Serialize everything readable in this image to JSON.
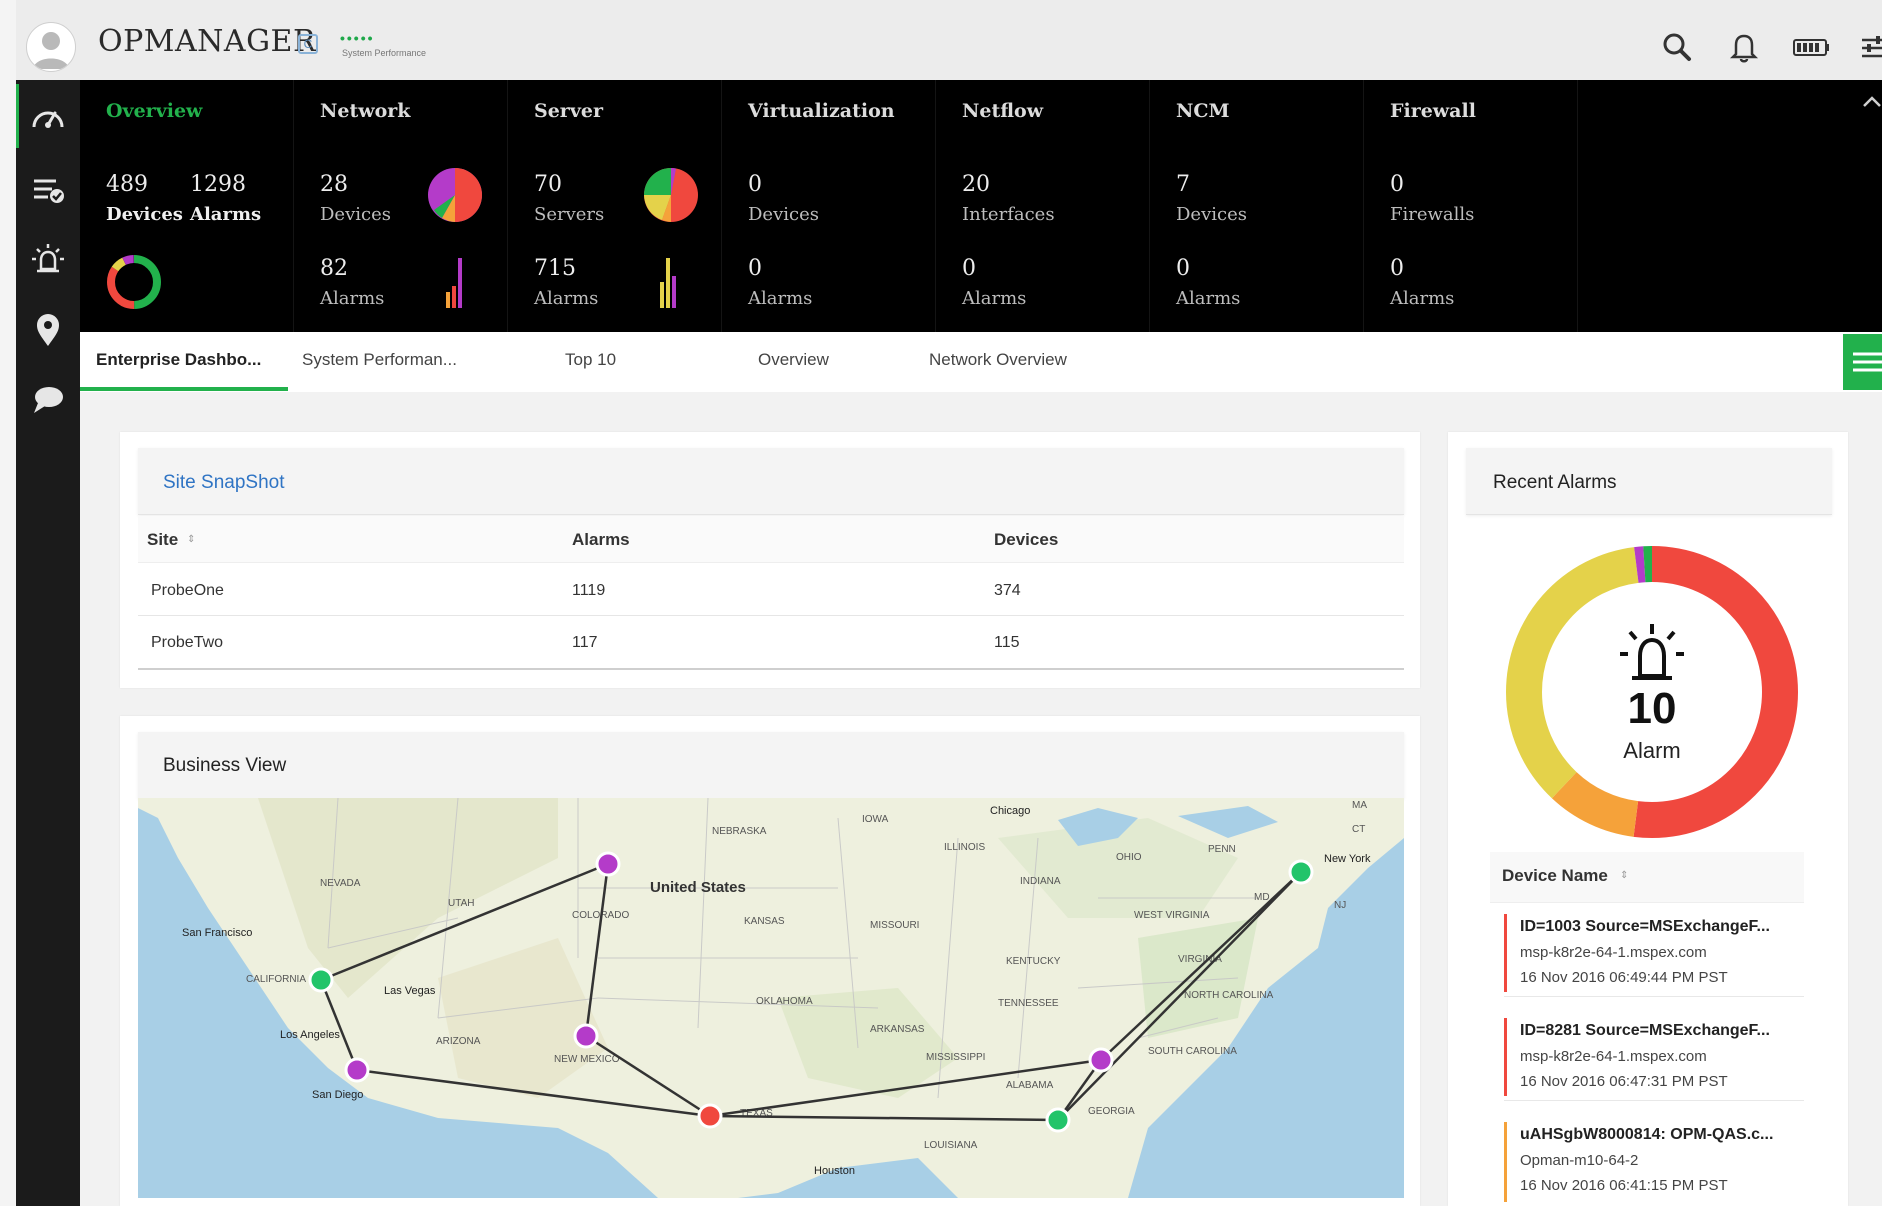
{
  "app": {
    "title": "OPMANAGER",
    "badge": "C",
    "perf_dots": "•••••",
    "perf_label": "System Performance"
  },
  "header_icons": [
    "search-icon",
    "bell-icon",
    "battery-icon",
    "settings-sliders-icon"
  ],
  "sidebar": [
    "dashboard-gauge-icon",
    "inventory-list-icon",
    "alarm-icon",
    "map-pin-icon",
    "chat-icon"
  ],
  "metrics": [
    {
      "title": "Overview",
      "v1": "489",
      "l1": "Devices",
      "v2": "1298",
      "l2": "Alarms"
    },
    {
      "title": "Network",
      "v1": "28",
      "l1": "Devices",
      "v2": "82",
      "l2": "Alarms"
    },
    {
      "title": "Server",
      "v1": "70",
      "l1": "Servers",
      "v2": "715",
      "l2": "Alarms"
    },
    {
      "title": "Virtualization",
      "v1": "0",
      "l1": "Devices",
      "v2": "0",
      "l2": "Alarms"
    },
    {
      "title": "Netflow",
      "v1": "20",
      "l1": "Interfaces",
      "v2": "0",
      "l2": "Alarms"
    },
    {
      "title": "NCM",
      "v1": "7",
      "l1": "Devices",
      "v2": "0",
      "l2": "Alarms"
    },
    {
      "title": "Firewall",
      "v1": "0",
      "l1": "Firewalls",
      "v2": "0",
      "l2": "Alarms"
    }
  ],
  "colors": {
    "accent": "#22b14c",
    "critical": "#f0483e",
    "major": "#f5a23a",
    "trouble": "#e4d24a",
    "purple": "#b43bc9",
    "link": "#2f74c4"
  },
  "tabs": [
    "Enterprise Dashbo...",
    "System Performan...",
    "Top 10",
    "Overview",
    "Network Overview"
  ],
  "site_snapshot": {
    "title": "Site SnapShot",
    "columns": [
      "Site",
      "Alarms",
      "Devices"
    ],
    "rows": [
      {
        "site": "ProbeOne",
        "alarms": "1119",
        "devices": "374"
      },
      {
        "site": "ProbeTwo",
        "alarms": "117",
        "devices": "115"
      }
    ]
  },
  "business_view": {
    "title": "Business View",
    "map": {
      "country": "United States",
      "cities": [
        "San Francisco",
        "Las Vegas",
        "Los Angeles",
        "San Diego",
        "Chicago",
        "New York",
        "Houston"
      ],
      "states": [
        "NEVADA",
        "UTAH",
        "CALIFORNIA",
        "ARIZONA",
        "COLORADO",
        "NEW MEXICO",
        "NEBRASKA",
        "KANSAS",
        "OKLAHOMA",
        "TEXAS",
        "IOWA",
        "ILLINOIS",
        "MISSOURI",
        "ARKANSAS",
        "MISSISSIPPI",
        "ALABAMA",
        "GEORGIA",
        "TENNESSEE",
        "KENTUCKY",
        "INDIANA",
        "OHIO",
        "PENN",
        "WEST VIRGINIA",
        "VIRGINIA",
        "NORTH CAROLINA",
        "SOUTH CAROLINA",
        "LOUISIANA",
        "MA",
        "CT",
        "NJ",
        "MD"
      ]
    }
  },
  "recent_alarms": {
    "title": "Recent Alarms",
    "count": "10",
    "count_label": "Alarm",
    "donut": [
      {
        "severity": "critical",
        "fraction": 0.52,
        "color": "#f0483e"
      },
      {
        "severity": "major",
        "fraction": 0.1,
        "color": "#f5a23a"
      },
      {
        "severity": "trouble",
        "fraction": 0.36,
        "color": "#e4d24a"
      },
      {
        "severity": "attention",
        "fraction": 0.01,
        "color": "#b43bc9"
      },
      {
        "severity": "clear",
        "fraction": 0.01,
        "color": "#22b14c"
      }
    ],
    "column": "Device Name",
    "entries": [
      {
        "title": "ID=1003 Source=MSExchangeF...",
        "host": "msp-k8r2e-64-1.mspex.com",
        "time": "16 Nov 2016 06:49:44 PM PST",
        "color": "#f0483e"
      },
      {
        "title": "ID=8281 Source=MSExchangeF...",
        "host": "msp-k8r2e-64-1.mspex.com",
        "time": "16 Nov 2016 06:47:31 PM PST",
        "color": "#f0483e"
      },
      {
        "title": "uAHSgbW8000814: OPM-QAS.c...",
        "host": "Opman-m10-64-2",
        "time": "16 Nov 2016 06:41:15 PM PST",
        "color": "#f5a23a"
      }
    ]
  }
}
